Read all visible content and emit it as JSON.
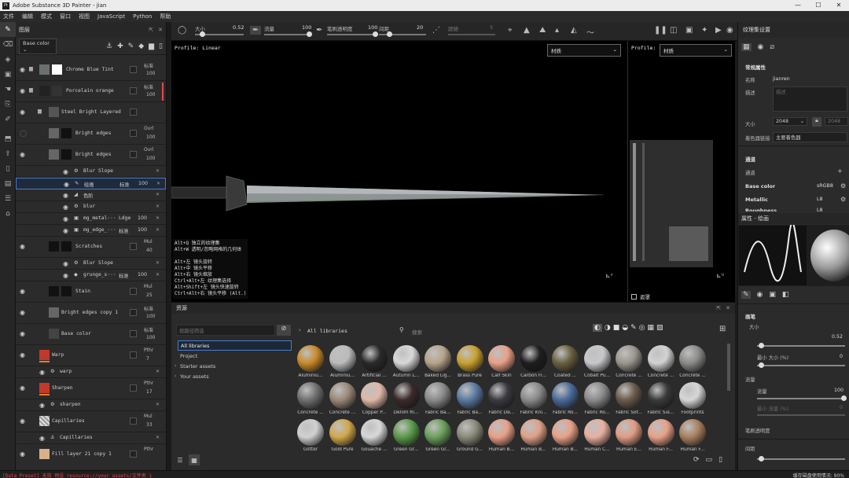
{
  "window": {
    "title": "Adobe Substance 3D Painter - jian"
  },
  "menu": [
    "文件",
    "编辑",
    "模式",
    "窗口",
    "视图",
    "JavaScript",
    "Python",
    "帮助"
  ],
  "propbar": {
    "size_label": "大小",
    "size_value": "0.52",
    "flow_label": "流量",
    "flow_value": "100",
    "opacity_label": "笔刷透明度",
    "opacity_value": "100",
    "spacing_label": "间距",
    "spacing_value": "20",
    "follow_label": "跟随",
    "follow_value": "5"
  },
  "layers": {
    "panel_title": "图层",
    "channel_select": "Base color",
    "rows": [
      {
        "name": "Chrome Blue Tint",
        "blend": "标准",
        "op": "100"
      },
      {
        "name": "Porcelain orange",
        "blend": "标准",
        "op": "100"
      },
      {
        "name": "Steel Bright Layered"
      },
      {
        "name": "Bright edges",
        "blend": "Ovrl",
        "op": "100"
      },
      {
        "name": "Bright edges",
        "blend": "Ovrl",
        "op": "100"
      },
      {
        "name": "Blur Slope"
      },
      {
        "name": "绘画",
        "blend": "标准",
        "op": "100"
      },
      {
        "name": "色阶"
      },
      {
        "name": "blur"
      },
      {
        "name": "mg_metal···",
        "blend": "Ldge",
        "op": "100"
      },
      {
        "name": "mg_edge_···",
        "blend": "标准",
        "op": "100"
      },
      {
        "name": "Scratches",
        "blend": "Mul",
        "op": "40"
      },
      {
        "name": "Blur Slope"
      },
      {
        "name": "grunge_s···",
        "blend": "标准",
        "op": "100"
      },
      {
        "name": "Stain",
        "blend": "Mul",
        "op": "25"
      },
      {
        "name": "Bright edges copy 1",
        "blend": "标准",
        "op": "100"
      },
      {
        "name": "Base color",
        "blend": "标准",
        "op": "100"
      },
      {
        "name": "Warp",
        "blend": "Pthr",
        "op": "7"
      },
      {
        "name": "warp"
      },
      {
        "name": "Sharpen",
        "blend": "Pthr",
        "op": "17"
      },
      {
        "name": "sharpen"
      },
      {
        "name": "Capillaries",
        "blend": "Mul",
        "op": "33"
      },
      {
        "name": "Capillaries"
      },
      {
        "name": "Fill layer 21 copy 1",
        "blend": "Pthr"
      }
    ]
  },
  "viewport": {
    "profile_3d": "Profile: Linear",
    "profile_2d": "Profile: Linear",
    "material_select_3d": "材质",
    "material_select_2d": "材质",
    "footer_2d": "遮罩",
    "shortcuts": [
      "Alt+Q      独立的纹理集",
      "Alt+W      透明/忽略网格的几何体",
      "",
      "Alt+左     镜头旋转",
      "Alt+中     镜头平移",
      "Alt+右     镜头缩放",
      "Ctrl+Alt+左 纹理集选择",
      "Alt+Shift+左 镜头快速旋转",
      "Ctrl+Alt+右 镜头平移 (Alt.)"
    ]
  },
  "assets": {
    "panel_title": "资源",
    "filter_placeholder": "按路径筛选",
    "search_placeholder": "搜索",
    "breadcrumb": "All libraries",
    "tree": [
      "All libraries",
      "Project",
      "Starter assets",
      "Your assets"
    ],
    "items": [
      {
        "label": "Aluminiu...",
        "color": "#c98a2a"
      },
      {
        "label": "Aluminiu...",
        "color": "#bbbbbb"
      },
      {
        "label": "Artificial ...",
        "color": "#2a2a2a"
      },
      {
        "label": "Autumn L...",
        "color": "#d8d8d8"
      },
      {
        "label": "Baked Lig...",
        "color": "#b6a48a"
      },
      {
        "label": "Brass Pure",
        "color": "#c9a030"
      },
      {
        "label": "Calf Skin",
        "color": "#e8a088"
      },
      {
        "label": "Carbon Fi...",
        "color": "#1e1e1e"
      },
      {
        "label": "Coated ...",
        "color": "#6a6040"
      },
      {
        "label": "Cobalt Pu...",
        "color": "#c8c8cc"
      },
      {
        "label": "Concrete ...",
        "color": "#9a968e"
      },
      {
        "label": "Concrete ...",
        "color": "#d2d2d2"
      },
      {
        "label": "Concrete ...",
        "color": "#8a8a88"
      },
      {
        "label": "Concrete ...",
        "color": "#707070"
      },
      {
        "label": "Concrete ...",
        "color": "#9a8878"
      },
      {
        "label": "Copper P...",
        "color": "#e0b8a8"
      },
      {
        "label": "Denim Ri...",
        "color": "#3a2a2a"
      },
      {
        "label": "Fabric Ba...",
        "color": "#8a8a8a"
      },
      {
        "label": "Fabric Ba...",
        "color": "#5a7aa0"
      },
      {
        "label": "Fabric De...",
        "color": "#3a3a40"
      },
      {
        "label": "Fabric Kni...",
        "color": "#8a8a8a"
      },
      {
        "label": "Fabric Ro...",
        "color": "#4a6a98"
      },
      {
        "label": "Fabric Ro...",
        "color": "#8a8a8a"
      },
      {
        "label": "Fabric Sof...",
        "color": "#6a5a4a"
      },
      {
        "label": "Fabric Sui...",
        "color": "#3a3a3a"
      },
      {
        "label": "Footprints",
        "color": "#d6d6d6"
      },
      {
        "label": "Glitter",
        "color": "#d0d0d0"
      },
      {
        "label": "Gold Pure",
        "color": "#d2a84a"
      },
      {
        "label": "Gouache ...",
        "color": "#d8d8d8"
      },
      {
        "label": "Green Gr...",
        "color": "#5a9a4a"
      },
      {
        "label": "Green Gr...",
        "color": "#6aa05a"
      },
      {
        "label": "Ground G...",
        "color": "#8a8a7a"
      },
      {
        "label": "Human B...",
        "color": "#e8a088"
      },
      {
        "label": "Human B...",
        "color": "#e0a088"
      },
      {
        "label": "Human B...",
        "color": "#e8a088"
      },
      {
        "label": "Human C...",
        "color": "#e8b0a0"
      },
      {
        "label": "Human E...",
        "color": "#e09c84"
      },
      {
        "label": "Human F...",
        "color": "#e8a088"
      },
      {
        "label": "Human F...",
        "color": "#a88060"
      }
    ]
  },
  "right_panel": {
    "title": "纹理集设置",
    "common_props": "常规属性",
    "name_label": "名称",
    "name_value": "jianren",
    "desc_label": "描述",
    "desc_placeholder": "描述",
    "size_label": "大小",
    "size_value": "2048",
    "size_value2": "2048",
    "shader_label": "着色器链接",
    "shader_value": "主要着色器",
    "channels_title": "通道",
    "channels_add": "通道",
    "channels": [
      {
        "name": "Base color",
        "fmt": "sRGB8"
      },
      {
        "name": "Metallic",
        "fmt": "L8"
      },
      {
        "name": "Roughness",
        "fmt": "L8"
      }
    ],
    "props_title": "属性 - 绘画",
    "brush_title": "画笔",
    "brush_size_label": "大小",
    "brush_size_value": "0.52",
    "min_size_label": "最小 大小 (%)",
    "min_size_value": "0",
    "flow_label": "流量",
    "flow_sub_label": "流量",
    "flow_value": "100",
    "min_flow_label": "最小 流量 (%)",
    "min_flow_value": "0",
    "opacity_label": "笔刷透明度",
    "spacing_label": "间距"
  },
  "status": {
    "error": "[Data Preset] 无效 预设 resource://your_assets/文件夹 1",
    "memory": "缓存磁盘使用情况:  90%"
  }
}
